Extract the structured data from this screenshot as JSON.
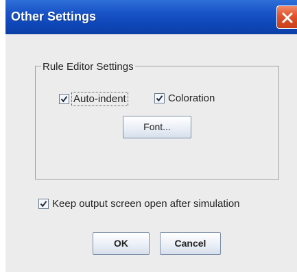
{
  "window": {
    "title": "Other Settings"
  },
  "rule_editor": {
    "group_label": "Rule Editor Settings",
    "auto_indent": {
      "label": "Auto-indent",
      "checked": true
    },
    "coloration": {
      "label": "Coloration",
      "checked": true
    },
    "font_button": "Font..."
  },
  "keep_output": {
    "label": "Keep output screen open after simulation",
    "checked": true
  },
  "buttons": {
    "ok": "OK",
    "cancel": "Cancel"
  }
}
